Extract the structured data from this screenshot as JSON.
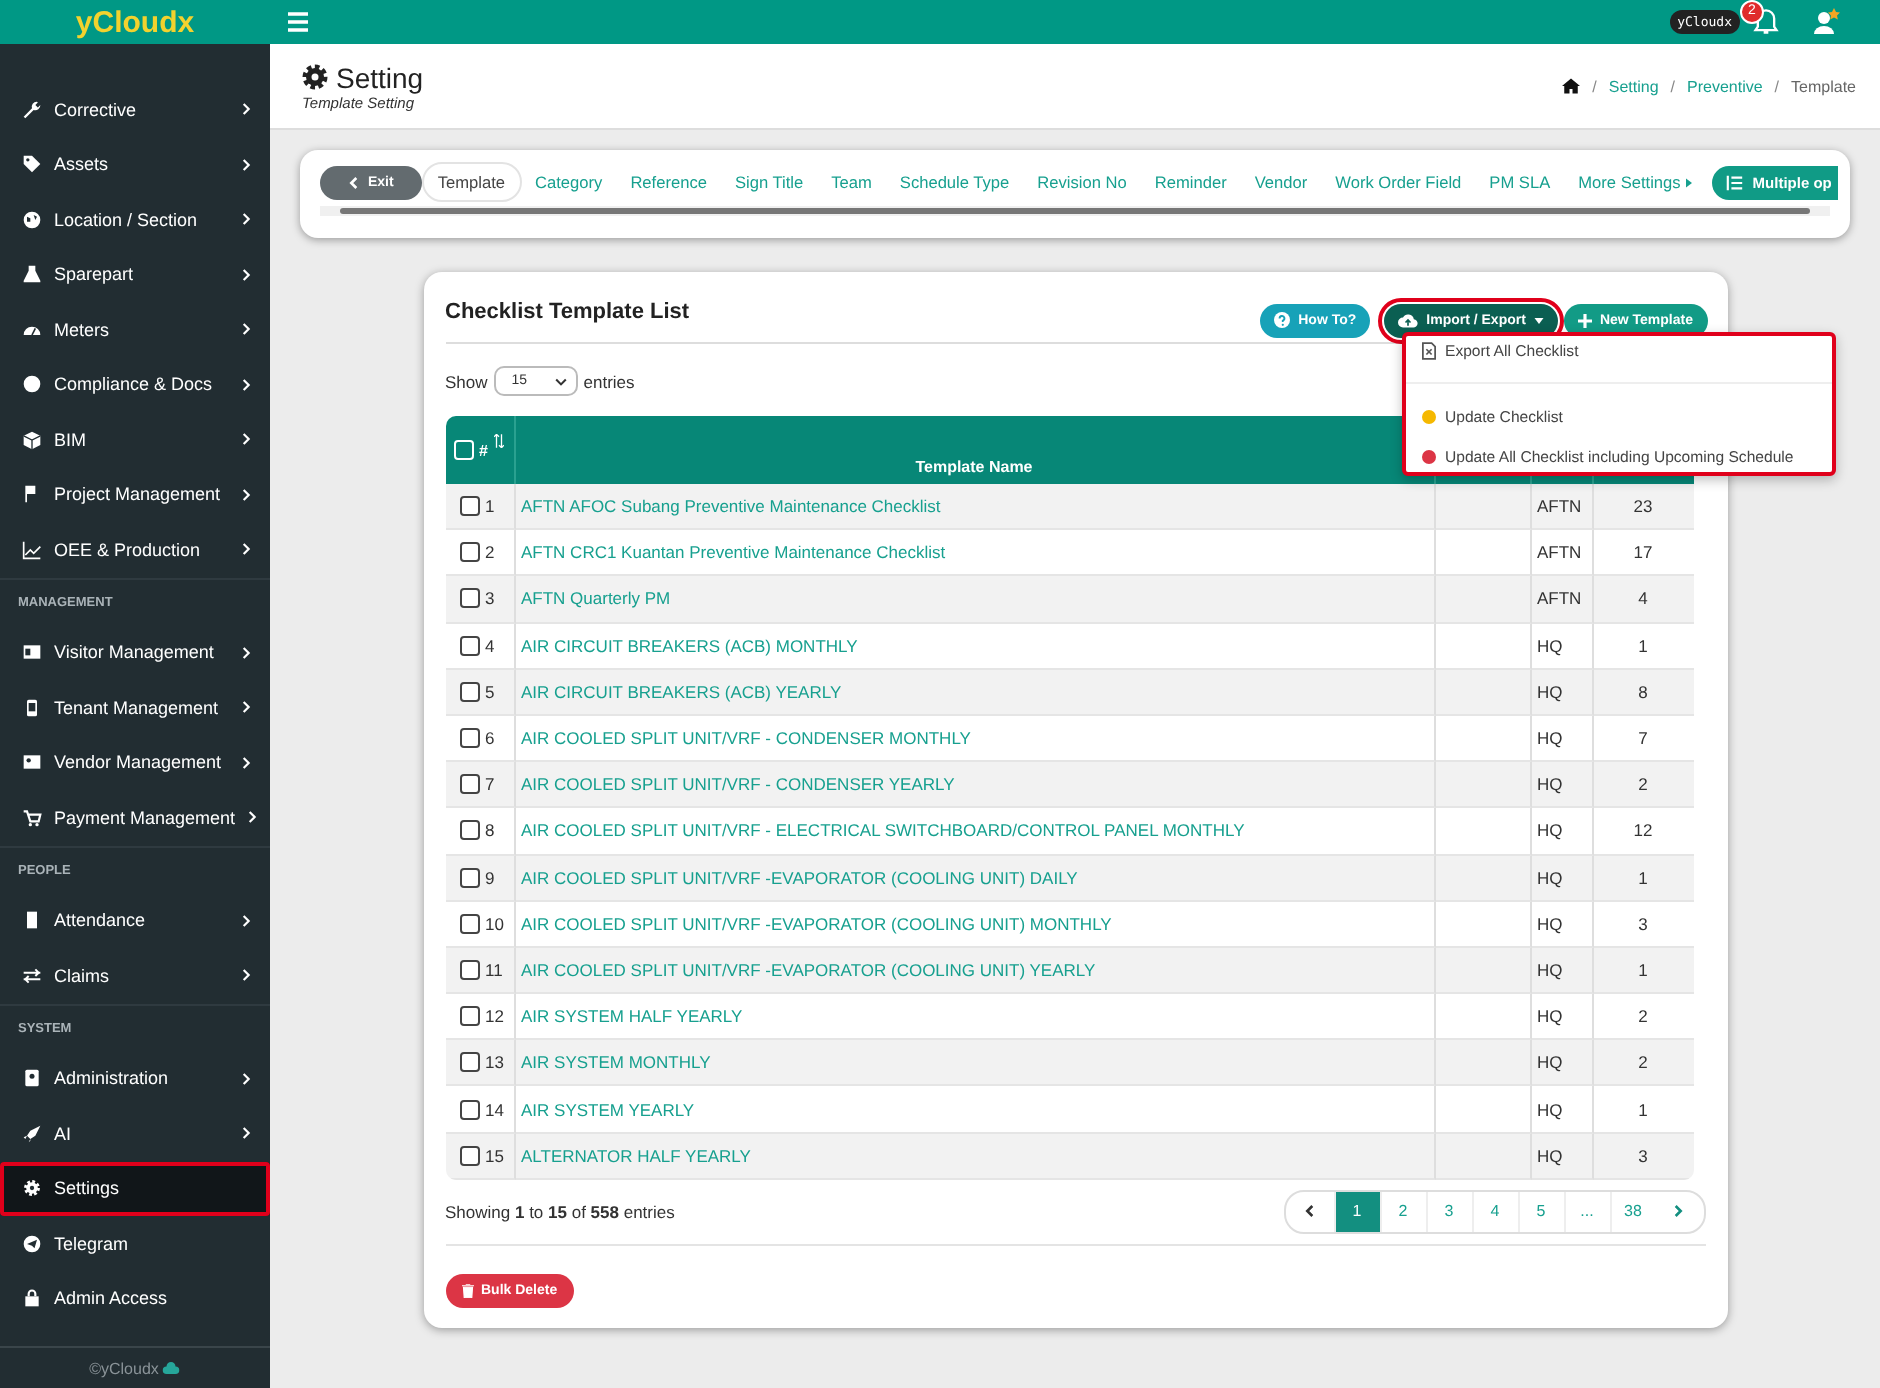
{
  "topbar": {
    "brand": "yCloudx",
    "user_badge": "yCloudx",
    "notification_count": "2"
  },
  "sidebar": {
    "sections": [
      {
        "items": [
          {
            "label": "Corrective",
            "has_submenu": true,
            "selected": false,
            "highlighted": false
          },
          {
            "label": "Assets",
            "has_submenu": true,
            "selected": false,
            "highlighted": false
          },
          {
            "label": "Location / Section",
            "has_submenu": true,
            "selected": false,
            "highlighted": false
          },
          {
            "label": "Sparepart",
            "has_submenu": true,
            "selected": false,
            "highlighted": false
          },
          {
            "label": "Meters",
            "has_submenu": true,
            "selected": false,
            "highlighted": false
          },
          {
            "label": "Compliance & Docs",
            "has_submenu": true,
            "selected": false,
            "highlighted": false
          },
          {
            "label": "BIM",
            "has_submenu": true,
            "selected": false,
            "highlighted": false
          },
          {
            "label": "Project Management",
            "has_submenu": true,
            "selected": false,
            "highlighted": false
          },
          {
            "label": "OEE & Production",
            "has_submenu": true,
            "selected": false,
            "highlighted": false
          }
        ]
      },
      {
        "heading": "MANAGEMENT",
        "items": [
          {
            "label": "Visitor Management",
            "has_submenu": true,
            "selected": false,
            "highlighted": false
          },
          {
            "label": "Tenant Management",
            "has_submenu": true,
            "selected": false,
            "highlighted": false
          },
          {
            "label": "Vendor Management",
            "has_submenu": true,
            "selected": false,
            "highlighted": false
          },
          {
            "label": "Payment Management",
            "has_submenu": true,
            "selected": false,
            "highlighted": false
          }
        ]
      },
      {
        "heading": "PEOPLE",
        "items": [
          {
            "label": "Attendance",
            "has_submenu": true,
            "selected": false,
            "highlighted": false
          },
          {
            "label": "Claims",
            "has_submenu": true,
            "selected": false,
            "highlighted": false
          }
        ]
      },
      {
        "heading": "SYSTEM",
        "items": [
          {
            "label": "Administration",
            "has_submenu": true,
            "selected": false,
            "highlighted": false
          },
          {
            "label": "AI",
            "has_submenu": true,
            "selected": false,
            "highlighted": false
          },
          {
            "label": "Settings",
            "has_submenu": false,
            "selected": true,
            "highlighted": true
          },
          {
            "label": "Telegram",
            "has_submenu": false,
            "selected": false,
            "highlighted": false
          },
          {
            "label": "Admin Access",
            "has_submenu": false,
            "selected": false,
            "highlighted": false
          }
        ]
      }
    ],
    "footer": "©yCloudx"
  },
  "page_header": {
    "title": "Setting",
    "subtitle": "Template Setting",
    "breadcrumb_separator": "/",
    "breadcrumb": [
      {
        "label": "Setting",
        "link": true
      },
      {
        "label": "Preventive",
        "link": true
      },
      {
        "label": "Template",
        "link": false
      }
    ]
  },
  "settings_tabs": {
    "exit": "Exit",
    "items": [
      {
        "label": "Template",
        "selected": true
      },
      {
        "label": "Category",
        "selected": false
      },
      {
        "label": "Reference",
        "selected": false
      },
      {
        "label": "Sign Title",
        "selected": false
      },
      {
        "label": "Team",
        "selected": false
      },
      {
        "label": "Schedule Type",
        "selected": false
      },
      {
        "label": "Revision No",
        "selected": false
      },
      {
        "label": "Reminder",
        "selected": false
      },
      {
        "label": "Vendor",
        "selected": false
      },
      {
        "label": "Work Order Field",
        "selected": false
      },
      {
        "label": "PM SLA",
        "selected": false
      },
      {
        "label": "More Settings",
        "selected": false,
        "kind": "dropdown"
      }
    ],
    "multiple_options": "Multiple op"
  },
  "card": {
    "title": "Checklist Template List",
    "how_to": "How To?",
    "import_export": {
      "label": "Import / Export",
      "highlighted": true,
      "expanded": true
    },
    "new_template": "New Template",
    "menu": {
      "highlighted": true,
      "items": [
        {
          "label": "Export All Checklist",
          "kind": "file"
        },
        {
          "label": "Update Checklist",
          "kind": "dot",
          "color": "#f5b800"
        },
        {
          "label": "Update All Checklist including Upcoming Schedule",
          "kind": "dot",
          "color": "#dc3545"
        }
      ]
    },
    "show": "Show",
    "page_size": "15",
    "entries": "entries",
    "table": {
      "header_checked": false,
      "columns": [
        "#",
        "Template Name"
      ],
      "rows": [
        {
          "no": "1",
          "name": "AFTN AFOC Subang Preventive Maintenance Checklist",
          "site": "AFTN",
          "count": "23",
          "checked": false
        },
        {
          "no": "2",
          "name": "AFTN CRC1 Kuantan Preventive Maintenance Checklist",
          "site": "AFTN",
          "count": "17",
          "checked": false
        },
        {
          "no": "3",
          "name": "AFTN Quarterly PM",
          "site": "AFTN",
          "count": "4",
          "checked": false
        },
        {
          "no": "4",
          "name": "AIR CIRCUIT BREAKERS (ACB) MONTHLY",
          "site": "HQ",
          "count": "1",
          "checked": false
        },
        {
          "no": "5",
          "name": "AIR CIRCUIT BREAKERS (ACB) YEARLY",
          "site": "HQ",
          "count": "8",
          "checked": false
        },
        {
          "no": "6",
          "name": "AIR COOLED SPLIT UNIT/VRF - CONDENSER MONTHLY",
          "site": "HQ",
          "count": "7",
          "checked": false
        },
        {
          "no": "7",
          "name": "AIR COOLED SPLIT UNIT/VRF - CONDENSER YEARLY",
          "site": "HQ",
          "count": "2",
          "checked": false
        },
        {
          "no": "8",
          "name": "AIR COOLED SPLIT UNIT/VRF - ELECTRICAL SWITCHBOARD/CONTROL PANEL MONTHLY",
          "site": "HQ",
          "count": "12",
          "checked": false
        },
        {
          "no": "9",
          "name": "AIR COOLED SPLIT UNIT/VRF -EVAPORATOR (COOLING UNIT) DAILY",
          "site": "HQ",
          "count": "1",
          "checked": false
        },
        {
          "no": "10",
          "name": "AIR COOLED SPLIT UNIT/VRF -EVAPORATOR (COOLING UNIT) MONTHLY",
          "site": "HQ",
          "count": "3",
          "checked": false
        },
        {
          "no": "11",
          "name": "AIR COOLED SPLIT UNIT/VRF -EVAPORATOR (COOLING UNIT) YEARLY",
          "site": "HQ",
          "count": "1",
          "checked": false
        },
        {
          "no": "12",
          "name": "AIR SYSTEM HALF YEARLY",
          "site": "HQ",
          "count": "2",
          "checked": false
        },
        {
          "no": "13",
          "name": "AIR SYSTEM MONTHLY",
          "site": "HQ",
          "count": "2",
          "checked": false
        },
        {
          "no": "14",
          "name": "AIR SYSTEM YEARLY",
          "site": "HQ",
          "count": "1",
          "checked": false
        },
        {
          "no": "15",
          "name": "ALTERNATOR HALF YEARLY",
          "site": "HQ",
          "count": "3",
          "checked": false
        }
      ]
    },
    "info": "Showing **1** to **15** of **558** entries",
    "pagination": {
      "pages": [
        {
          "label": "1",
          "selected": true
        },
        {
          "label": "2",
          "selected": false
        },
        {
          "label": "3",
          "selected": false
        },
        {
          "label": "4",
          "selected": false
        },
        {
          "label": "5",
          "selected": false
        },
        {
          "label": "...",
          "selected": false
        },
        {
          "label": "38",
          "selected": false
        }
      ]
    },
    "bulk_delete": "Bulk Delete"
  }
}
